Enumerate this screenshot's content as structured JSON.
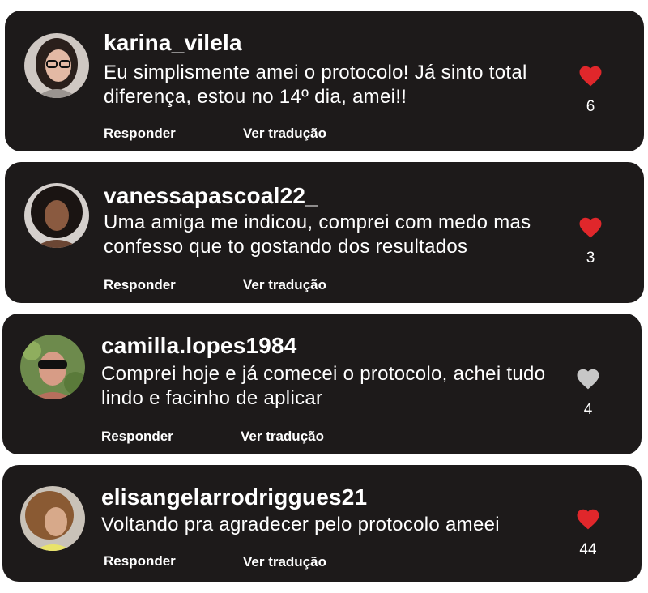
{
  "comments": [
    {
      "username": "karina_vilela",
      "text": "Eu simplismente amei o protocolo! Já sinto total diferença, estou no 14º dia, amei!!",
      "reply_label": "Responder",
      "translate_label": "Ver tradução",
      "likes": "6",
      "liked": true
    },
    {
      "username": "vanessapascoal22_",
      "text": "Uma amiga me indicou, comprei com medo mas confesso que to gostando dos resultados",
      "reply_label": "Responder",
      "translate_label": "Ver tradução",
      "likes": "3",
      "liked": true
    },
    {
      "username": "camilla.lopes1984",
      "text": "Comprei hoje e já comecei o protocolo, achei tudo lindo e facinho de aplicar",
      "reply_label": "Responder",
      "translate_label": "Ver tradução",
      "likes": "4",
      "liked": false
    },
    {
      "username": "elisangelarrodriggues21",
      "text": "Voltando pra agradecer pelo protocolo ameei",
      "reply_label": "Responder",
      "translate_label": "Ver tradução",
      "likes": "44",
      "liked": true
    }
  ],
  "colors": {
    "card_bg": "#1d1a1a",
    "liked_heart": "#e0272b",
    "unliked_heart": "#c7c7c7",
    "text": "#ffffff"
  },
  "icons": {
    "liked": "heart-filled-red-icon",
    "unliked": "heart-filled-gray-icon"
  }
}
